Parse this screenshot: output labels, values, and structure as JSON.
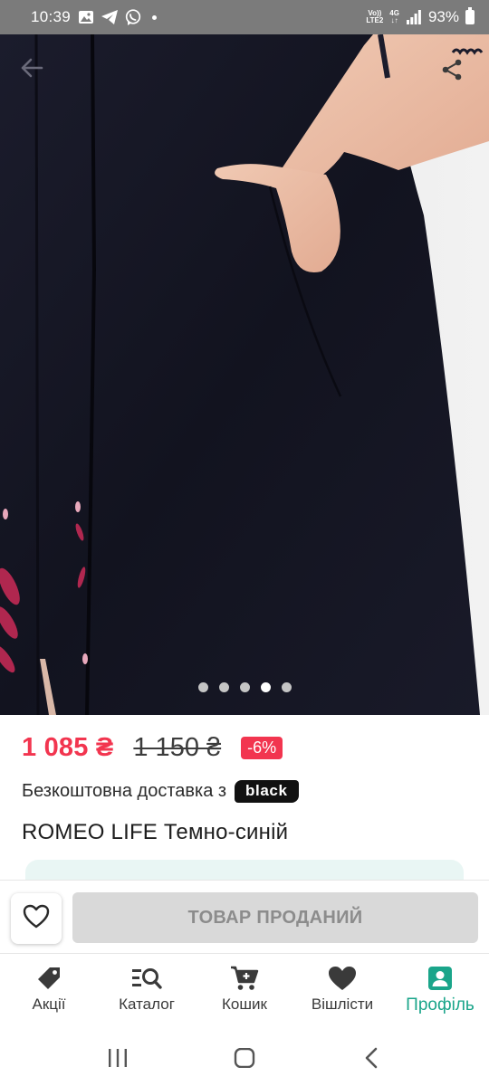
{
  "status_bar": {
    "time": "10:39",
    "volte_line1": "Vo))",
    "volte_line2": "LTE2",
    "net_line1": "4G",
    "net_line2": "↓↑",
    "battery": "93%",
    "battery_level": 0.93
  },
  "gallery": {
    "pages": 5,
    "active_page": 4
  },
  "price": {
    "current": "1 085 ₴",
    "old": "1 150 ₴",
    "discount": "-6%",
    "colors": {
      "price": "#f2354f",
      "badge": "#f2354f"
    }
  },
  "delivery": {
    "text": "Безкоштовна доставка з",
    "badge": "black"
  },
  "product": {
    "title": "ROMEO LIFE Темно-синій"
  },
  "actions": {
    "sold_label": "ТОВАР ПРОДАНИЙ"
  },
  "nav": {
    "items": [
      {
        "label": "Акції",
        "icon": "tag-icon"
      },
      {
        "label": "Каталог",
        "icon": "catalog-search-icon"
      },
      {
        "label": "Кошик",
        "icon": "cart-icon"
      },
      {
        "label": "Вішлісти",
        "icon": "heart-icon"
      },
      {
        "label": "Профіль",
        "icon": "profile-icon",
        "active": true
      }
    ],
    "accent": "#1aa58a"
  }
}
